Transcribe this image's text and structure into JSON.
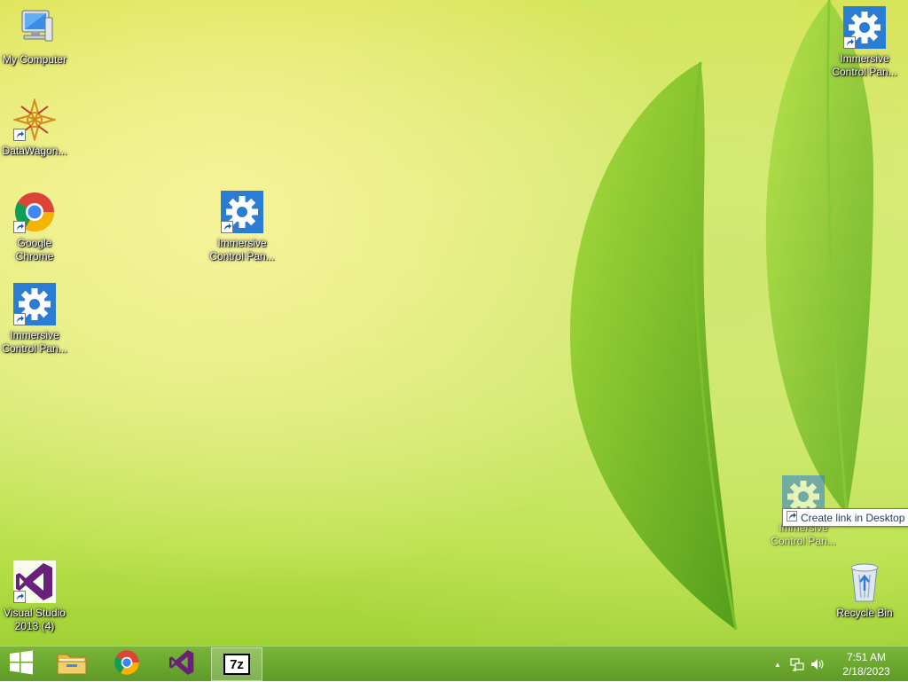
{
  "desktop": {
    "icons": [
      {
        "label": "My Computer",
        "glyph": "computer-icon"
      },
      {
        "label": "DataWagon...",
        "glyph": "datawagon-icon"
      },
      {
        "label": "Google\nChrome",
        "glyph": "chrome-icon"
      },
      {
        "label": "Immersive\nControl Pan...",
        "glyph": "gear-icon"
      },
      {
        "label": "Visual Studio\n2013 (4)",
        "glyph": "visual-studio-icon"
      },
      {
        "label": "Immersive\nControl Pan...",
        "glyph": "gear-icon"
      },
      {
        "label": "Immersive\nControl Pan...",
        "glyph": "gear-icon"
      },
      {
        "label": "Recycle Bin",
        "glyph": "recycle-bin-icon"
      }
    ],
    "drag_ghost": {
      "label": "Immersive\nControl Pan...",
      "glyph": "gear-icon"
    },
    "drag_tooltip": "Create link in Desktop"
  },
  "taskbar": {
    "buttons": [
      {
        "name": "start",
        "glyph": "windows-logo-icon"
      },
      {
        "name": "file-explorer",
        "glyph": "folder-icon"
      },
      {
        "name": "google-chrome",
        "glyph": "chrome-icon"
      },
      {
        "name": "visual-studio",
        "glyph": "visual-studio-icon"
      },
      {
        "name": "7-zip",
        "glyph": "7zip-icon",
        "text": "7z",
        "active": true
      }
    ],
    "tray": {
      "show_hidden": "▲",
      "clock_time": "7:51 AM",
      "clock_date": "2/18/2023"
    }
  },
  "colors": {
    "gear_blue": "#2b7cd3",
    "vs_purple": "#68217a",
    "taskbar_green": "#6aa72e"
  }
}
